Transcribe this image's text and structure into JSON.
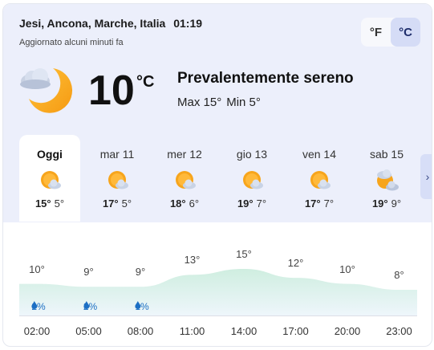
{
  "header": {
    "location": "Jesi, Ancona, Marche, Italia",
    "time": "01:19",
    "updated": "Aggiornato alcuni minuti fa"
  },
  "units": {
    "f_label": "°F",
    "c_label": "°C",
    "selected": "c"
  },
  "current": {
    "icon": "moon-cloud-icon",
    "temp": "10",
    "unit": "°C",
    "condition": "Prevalentemente sereno",
    "max": "Max 15°",
    "min": "Min 5°"
  },
  "days": [
    {
      "label": "Oggi",
      "max": "15°",
      "min": "5°",
      "icon": "sun-cloud-icon",
      "selected": true
    },
    {
      "label": "mar 11",
      "max": "17°",
      "min": "5°",
      "icon": "sun-cloud-icon"
    },
    {
      "label": "mer 12",
      "max": "18°",
      "min": "6°",
      "icon": "sun-cloud-icon"
    },
    {
      "label": "gio 13",
      "max": "19°",
      "min": "7°",
      "icon": "sun-cloud-icon"
    },
    {
      "label": "ven 14",
      "max": "17°",
      "min": "7°",
      "icon": "sun-cloud-icon"
    },
    {
      "label": "sab 15",
      "max": "19°",
      "min": "9°",
      "icon": "partly-cloudy-icon"
    }
  ],
  "next_label": "›",
  "hourly": {
    "hours": [
      "02:00",
      "05:00",
      "08:00",
      "11:00",
      "14:00",
      "17:00",
      "20:00",
      "23:00"
    ],
    "temps": [
      10,
      9,
      9,
      13,
      15,
      12,
      10,
      8
    ],
    "temp_labels": [
      "10°",
      "9°",
      "9°",
      "13°",
      "15°",
      "12°",
      "10°",
      "8°"
    ],
    "precip": [
      "2%",
      "2%",
      "1%",
      "",
      "",
      "",
      "",
      ""
    ],
    "colors": {
      "area_top": "#cfeee0",
      "area_bottom": "#eef6fb",
      "precip": "#1c6fc4"
    }
  }
}
